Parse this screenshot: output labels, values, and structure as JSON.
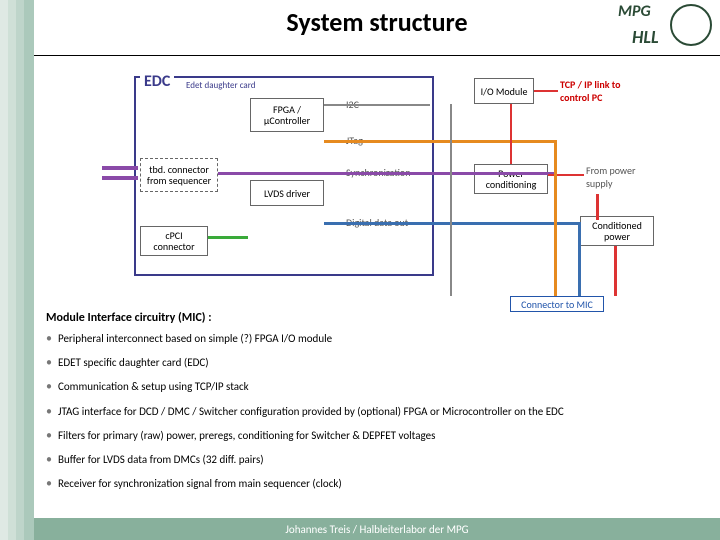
{
  "header": {
    "title": "System structure",
    "logo_top": "MPG",
    "logo_bottom": "HLL"
  },
  "diagram": {
    "edc_title": "EDC",
    "edc_sub": "Edet daughter card",
    "boxes": {
      "fpga": "FPGA / µController",
      "lvds": "LVDS driver",
      "tbd_conn": "tbd. connector from sequencer",
      "cpci": "cPCI connector",
      "io_module": "I/O Module",
      "power_cond": "Power conditioning",
      "cond_power": "Conditioned power",
      "conn_mic": "Connector to MIC"
    },
    "labels": {
      "i2c": "I2C",
      "jtag": "JTag",
      "sync": "Synchronization",
      "digital": "Digital data out",
      "tcp": "TCP / IP link to control PC",
      "from_ps": "From power supply"
    }
  },
  "section_title": "Module Interface circuitry (MIC) :",
  "bullets": [
    "Peripheral interconnect based on simple (?) FPGA I/O module",
    "EDET specific daughter card (EDC)",
    "Communication & setup using TCP/IP stack",
    "JTAG interface for DCD / DMC / Switcher configuration provided by (optional) FPGA or Microcontroller on the EDC",
    "Filters for primary (raw) power, preregs, conditioning for Switcher & DEPFET voltages",
    "Buffer for LVDS data from DMCs (32 diff. pairs)",
    "Receiver for synchronization signal from main sequencer (clock)"
  ],
  "footer": "Johannes Treis / Halbleiterlabor der MPG"
}
